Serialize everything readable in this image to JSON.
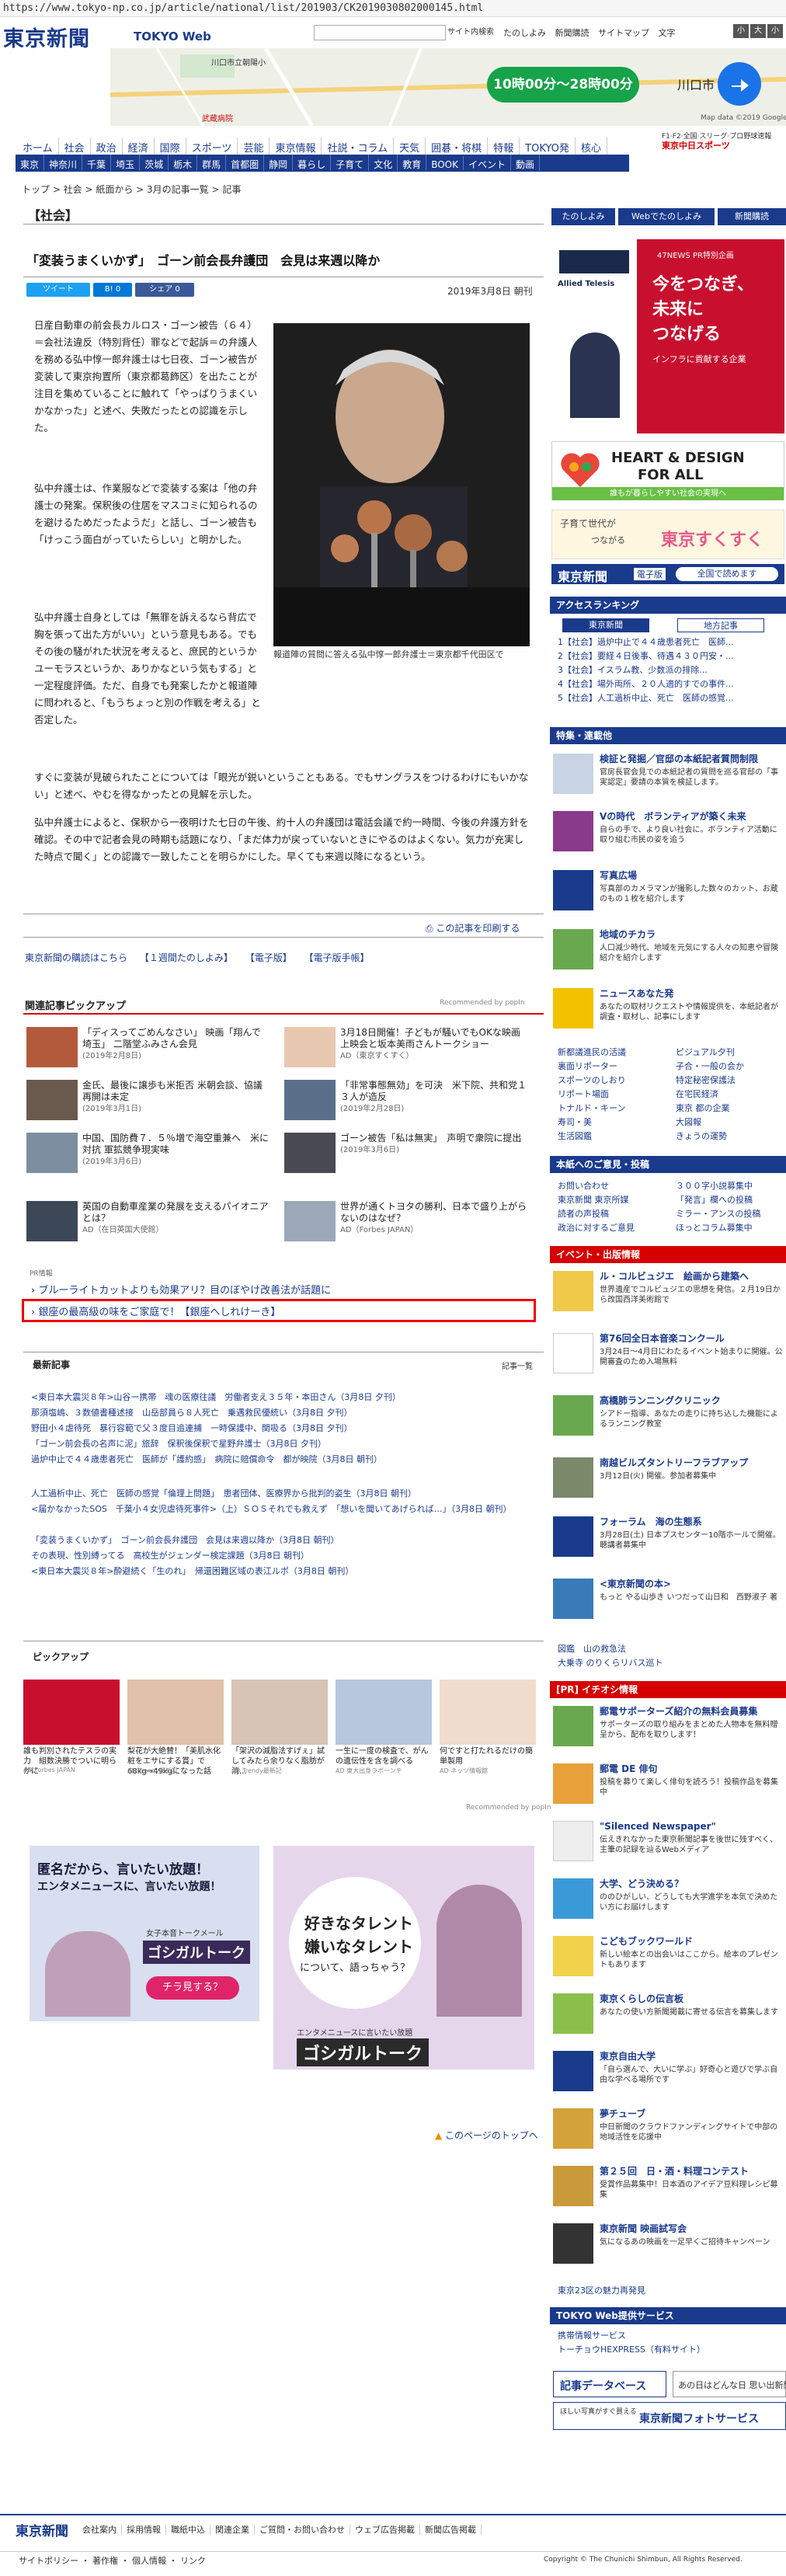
{
  "url": "https://www.tokyo-np.co.jp/article/national/list/201903/CK2019030802000145.html",
  "header": {
    "logo": "東京新聞",
    "logo_sub": "TOKYO Web",
    "search_btn": "サイト内検索",
    "links": [
      "たのしよみ",
      "新聞購読",
      "サイトマップ"
    ],
    "font_size_label": "文字",
    "font_sizes": [
      "小",
      "大",
      "小"
    ]
  },
  "map": {
    "route_time": "10時00分〜28時00分",
    "city": "川口市",
    "credit": "Map data ©2019 Google, ZENRIN",
    "station": "川口市立朝陽小",
    "place": "武蔵病院"
  },
  "nav": {
    "primary": [
      "ホーム",
      "社会",
      "政治",
      "経済",
      "国際",
      "スポーツ",
      "芸能",
      "東京情報",
      "社説・コラム",
      "天気",
      "囲碁・将棋",
      "特報",
      "TOKYO発",
      "核心"
    ],
    "right_top": "F1·F2·全国·スリーグ·プロ野球速報",
    "right_brand": "東京中日スポーツ",
    "secondary": [
      "東京",
      "神奈川",
      "千葉",
      "埼玉",
      "茨城",
      "栃木",
      "群馬",
      "首都圏",
      "静岡",
      "暮らし",
      "子育て",
      "文化",
      "教育",
      "BOOK",
      "イベント",
      "動画"
    ]
  },
  "breadcrumb": "トップ > 社会 > 紙面から > 3月の記事一覧 > 記事",
  "article": {
    "section": "【社会】",
    "title": "「変装うまくいかず」　ゴーン前会長弁護団　会見は来週以降か",
    "social": [
      "ツイート",
      "B! 0",
      "シェア 0"
    ],
    "date": "2019年3月8日 朝刊",
    "p1": "日産自動車の前会長カルロス・ゴーン被告（６４）＝会社法違反（特別背任）罪などで起訴＝の弁護人を務める弘中惇一郎弁護士は七日夜、ゴーン被告が変装して東京拘置所（東京都葛飾区）を出たことが注目を集めていることに触れて「やっぱりうまくいかなかった」と述べ、失敗だったとの認識を示した。",
    "p2": "弘中弁護士は、作業服などで変装する案は「他の弁護士の発案。保釈後の住居をマスコミに知られるのを避けるためだったようだ」と話し、ゴーン被告も「けっこう面白がっていたらしい」と明かした。",
    "p3": "弘中弁護士自身としては「無罪を訴えるなら背広で胸を張って出た方がいい」という意見もある。でもその後の騒がれた状況を考えると、庶民的というかユーモラスというか、ありかなという気もする」と一定程度評価。ただ、自身でも発案したかと報道陣に問われると、「もうちょっと別の作戦を考える」と否定した。",
    "p4": "すぐに変装が見破られたことについては「眼光が鋭いということもある。でもサングラスをつけるわけにもいかない」と述べ、やむを得なかったとの見解を示した。",
    "p5": "弘中弁護士によると、保釈から一夜明けた七日の午後、約十人の弁護団は電話会議で約一時間、今後の弁護方針を確認。その中で記者会見の時期も話題になり、「まだ体力が戻っていないときにやるのはよくない。気力が充実した時点で聞く」との認識で一致したことを明らかにした。早くても来週以降になるという。",
    "caption": "報道陣の質問に答える弘中惇一郎弁護士＝東京都千代田区で",
    "print": "この記事を印刷する",
    "related_links": [
      "東京新聞の購読はこちら",
      "【１週間たのしよみ】",
      "【電子版】",
      "【電子版手帳】"
    ]
  },
  "pickup": {
    "title": "関連記事ピックアップ",
    "recommended": "Recommended by popIn",
    "items": [
      {
        "text": "「ディスってごめんなさい」 映画「翔んで埼玉」 二階堂ふみさん会見",
        "sub": "(2019年2月8日)"
      },
      {
        "text": "3月18日開催！子どもが騒いでもOKな映画上映会と坂本美雨さんトークショー",
        "sub": "AD（東京すくすく）"
      },
      {
        "text": "金氏、最後に譲歩も米拒否 米朝会談、協議再開は未定",
        "sub": "(2019年3月1日)"
      },
      {
        "text": "「非常事態無効」を可決　米下院、共和党１３人が造反",
        "sub": "(2019年2月28日)"
      },
      {
        "text": "中国、国防費７．５％増で海空重兼へ　米に対抗 軍拡競争現実味",
        "sub": "(2019年3月6日)"
      },
      {
        "text": "ゴーン被告「私は無実」　声明で衆院に提出",
        "sub": "(2019年3月6日)"
      },
      {
        "text": "英国の自動車産業の発展を支えるパイオニアとは？",
        "sub": "AD（在日英国大使館）"
      },
      {
        "text": "世界が通くトヨタの勝利、日本で盛り上がらないのはなぜ？",
        "sub": "AD（Forbes JAPAN）"
      }
    ]
  },
  "sponsored": {
    "label": "PR情報",
    "link1": "ブルーライトカットよりも効果アリ？目のぼやけ改善法が話題に",
    "link2": "銀座の最高級の味をご家庭で！【銀座へしれけーき】"
  },
  "latest": {
    "title": "最新記事",
    "more": "記事一覧",
    "items": [
      "<東日本大震災８年>山谷ー携帯　魂の医療往議　労働者支え３５年・本田さん（3月8日 夕刊）",
      "那須塩嶋、３数値書種述接　山岳部員ら８人死亡　乗遇救民優統い（3月8日 夕刊）",
      "野田小４虐待死　暴行容範で父３度目追連捕　一時保護中、関吸る（3月8日 夕刊）",
      "「ゴーン前会長の名声に泥」旅辞　保釈後保釈で星野弁護士（3月8日 夕刊）",
      "過炉中止で４４歳患者死亡　医師が「護約感」　病院に賠償命令　都が映院（3月8日 朝刊）",
      "人工過析中止、死亡　医師の感覚「倫理上問題」　患者団体、医療界から批判的姿生（3月8日 朝刊）",
      "<届かなかったSOS　千葉小４女児虐待死事件>（上）ＳＯＳそれでも救えず　「想いを聞いてあげられば…」（3月8日 朝刊）",
      "「変装うまくいかず」　ゴーン前会長弁護団　会見は来週以降か（3月8日 朝刊）",
      "その表現、性別縛ってる　高校生がジェンダー検定課題（3月8日 朝刊）",
      "<東日本大震災８年>酔避続く「生のれ」　帰還困難区域の表江ルポ（3月8日 朝刊）"
    ]
  },
  "pick": {
    "title": "ピックアップ",
    "recommended": "Recommended by popIn",
    "items": [
      {
        "text": "誰も判別されたテスラの実力　組数決勝でついに明らかに",
        "src": "AD Forbes JAPAN"
      },
      {
        "text": "梨花が大絶賛！「美肌水化粧をエサにする賞」で68kg→49kgになった話",
        "src": "AD Trendy最新記"
      },
      {
        "text": "「架沢の減脂法すげぇ」試してみたら余りなく脂肪が消...",
        "src": "AD Trendy最新記"
      },
      {
        "text": "一生に一度の検査で、がんの遺伝性を含を調べる",
        "src": "AD 東大出身ラボーンチ"
      },
      {
        "text": "何ですと打たれるだけの簡単製用",
        "src": "AD ネッツ情報館"
      }
    ]
  },
  "ads": {
    "a1_line1": "匿名だから、言いたい放題！",
    "a1_line2": "エンタメニュースに、言いたい放題！",
    "a1_sub": "女子本音トークメール",
    "a1_brand": "ゴシガルトーク",
    "a1_btn": "チラ見する？",
    "a2_line1": "好きなタレント",
    "a2_line2": "嫌いなタレント",
    "a2_line3": "について、語っちゃう？",
    "a2_sub": "エンタメニュースに言いたい放題",
    "a2_brand": "ゴシガルトーク"
  },
  "page_top": "このページのトップへ",
  "sidebar": {
    "buttons": [
      "たのしよみ",
      "Webでたのしよみ",
      "新聞購読"
    ],
    "ad1_brand": "Allied Telesis",
    "ad1_tag": "47NEWS PR特別企画",
    "ad1_line1": "今をつなぎ、",
    "ad1_line2": "未来に",
    "ad1_line3": "つなげる",
    "ad1_sub": "インフラに貢献する企業",
    "ad2_line1": "HEART & DESIGN",
    "ad2_line2": "FOR ALL",
    "ad2_sub": "誰もが暮らしやすい社会の実現へ",
    "ad3_line1": "子育て世代が",
    "ad3_line2": "つながる",
    "ad3_brand": "東京すくすく",
    "ad4_brand": "東京新聞",
    "ad4_tag": "電子版",
    "ad4_sub": "全国で読めます",
    "ranking_title": "アクセスランキング",
    "ranking_tabs": [
      "東京新聞",
      "地方記事"
    ],
    "ranking": [
      "1【社会】過炉中止で４４歳患者死亡　医師...",
      "2【社会】要経４日後事、待遇４３０円安・...",
      "3【社会】イスラム教、少数派の排除...",
      "4【社会】場外両所、２０人適的すでの事件...",
      "5【社会】人工過析中止、死亡　医師の感覚..."
    ],
    "feature_title": "特集・連載他",
    "features": [
      {
        "head": "検証と発掘／官邸の本紙記者質問制限",
        "desc": "官房長官会見での本紙記者の質問を巡る官邸の「事実認定」要請の本質を検証します。"
      },
      {
        "head": "Vの時代　ボランティアが築く未来",
        "desc": "自らの手で、より良い社会に。ボランティア活動に取り組む市民の姿を追う"
      },
      {
        "head": "写真広場",
        "desc": "写真部のカメラマンが撮影した数々のカット、お蔵のもの１枚を紹介します"
      },
      {
        "head": "地域のチカラ",
        "desc": "人口減少時代、地域を元気にする人々の知恵や冒険紹介を紹介します"
      },
      {
        "head": "ニュースあなた発",
        "desc": "あなたの取材リクエストや情報提供を、本紙記者が調査・取材し、記事にします"
      }
    ],
    "links_left": [
      "新都議進民の活議",
      "裏面リポーター",
      "スポーツのしおり",
      "リポート場面",
      "トナルド・キーン",
      "寿司・美",
      "生活図鑑"
    ],
    "links_right": [
      "ピジュアル夕刊",
      "子合・一般の会か",
      "特定秘密保護法",
      "在宅民経済",
      "東京 都の企業",
      "大図報",
      "きょうの運勢"
    ],
    "service_title": "本紙へのご意見・投稿",
    "service_left": [
      "お問い合わせ",
      "東京新聞 東京所媒",
      "読者の声投稿",
      "政治に対するご意見"
    ],
    "service_right": [
      "３００字小説募集中",
      "「発言」欄への投稿",
      "ミラー・アンスの投稿",
      "ほっとコラム募集中"
    ],
    "event_title": "イベント・出版情報",
    "events": [
      {
        "head": "ル・コルビュジエ　絵画から建築へ",
        "desc": "世界遺産でコルビュジエの思想を発信。２月19日から改国西洋美術館で"
      },
      {
        "head": "第76回全日本音楽コンクール",
        "desc": "3月24日〜4月日にわたるイベント始まりに開催。公開審査のため入場無料"
      },
      {
        "head": "高橋肺ランニングクリニック",
        "desc": "シアドー指導、あなたの走りに持ち込した機能によるランニング教室"
      },
      {
        "head": "南越ビルズタントリーフラブアップ",
        "desc": "3月12日(火) 開催。参加者募集中"
      },
      {
        "head": "フォーラム　海の生態系",
        "desc": "3月28日(土) 日本プスセンター10階ホールで開催。聴講者募集中"
      },
      {
        "head": "<東京新聞の本>",
        "desc": "もっと やる山歩き いつだって山日和　西野淑子 著"
      }
    ],
    "event_links": [
      "図鑑　山の救急法",
      "大乗寺 のりくらリバス巡ト"
    ],
    "pr_title": "[PR] イチオシ情報",
    "prs": [
      {
        "head": "郵電サポーターズ紹介の無料会員募集",
        "desc": "サポーターズの取り組みをまとめた人物本を無料贈呈から、配布を取りします！"
      },
      {
        "head": "郵電 DE 俳句",
        "desc": "投稿を募りて楽しく俳句を読ろう！投稿作品を募集中"
      },
      {
        "head": "\"Silenced Newspaper\"",
        "desc": "伝えきれなかった東京新聞記事を後世に残すべく、主筆の記録を辿るWebメディア"
      },
      {
        "head": "大学、どう決める？",
        "desc": "ののひがしい、どうしても大学進学を本気で決めたい方にお届けします"
      },
      {
        "head": "こどもブックワールド",
        "desc": "新しい絵本との出会いはここから。絵本のプレゼントもあります"
      },
      {
        "head": "東京くらしの伝言板",
        "desc": "あなたの使い方新聞掲載に寄せる伝言を募集します"
      },
      {
        "head": "東京自由大学",
        "desc": "「自ら選んで、大いに学ぶ」好奇心と遊びで学ぶ自由な学べる場所です"
      },
      {
        "head": "夢チューブ",
        "desc": "中日新聞のクラウドファンディングサイトで中部の地域活性を応援中"
      },
      {
        "head": "第２５回　日・酒・料理コンテスト",
        "desc": "受賞作品募集中！日本酒のアイデア豆料理レシピ募集"
      },
      {
        "head": "東京新聞 映画試写会",
        "desc": "気になるあの映画を一足早くご招待キャンペーン"
      }
    ],
    "pr_link": "東京23区の魅力再発見",
    "tokyoweb_title": "TOKYO Web提供サービス",
    "tokyoweb_links": [
      "携帯情報サービス",
      "トーチョウHEXPRESS（有料サイト）"
    ],
    "bottom_btns": [
      "記事データベース",
      "あの日はどんな日 思い出新聞"
    ],
    "bottom_banner": "東京新聞フォトサービス",
    "bottom_banner_sub": "ほしい写真がすぐ買える"
  },
  "footer": {
    "logo": "東京新聞",
    "links": [
      "会社案内",
      "採用情報",
      "職紙中込",
      "関連企業",
      "ご質問・お問い合わせ",
      "ウェブ広告掲載",
      "新聞広告掲載"
    ],
    "links2": [
      "サイトポリシー",
      "著作権",
      "個人情報",
      "リンク"
    ],
    "copyright": "Copyright © The Chunichi Shimbun, All Rights Reserved."
  },
  "colors": {
    "brand": "#1a3a8c",
    "accent": "#d60000",
    "highlight": "#e00000"
  }
}
